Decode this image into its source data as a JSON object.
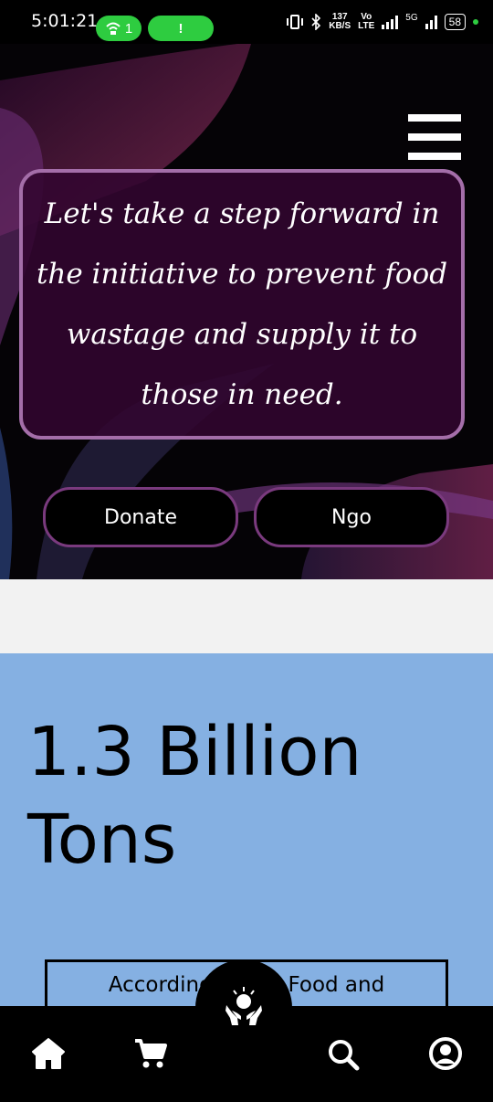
{
  "status_bar": {
    "time": "5:01:21",
    "hotspot_count": "1",
    "alert": "!",
    "speed_value": "137",
    "speed_unit": "KB/S",
    "volte_top": "Vo",
    "volte_bottom": "LTE",
    "network": "5G",
    "battery": "58"
  },
  "hero": {
    "quote": "Let's take a step forward in the initiative to prevent food wastage and supply it to those in need.",
    "donate_label": "Donate",
    "ngo_label": "Ngo"
  },
  "stats": {
    "heading": "1.3 Billion Tons",
    "info_text": "According to the Food and"
  },
  "bottom_nav": {
    "items": [
      "home-icon",
      "cart-icon",
      "donate-hands-icon",
      "search-icon",
      "profile-icon"
    ]
  },
  "colors": {
    "hero_card_border": "#a46ea9",
    "stats_background": "#85b0e2",
    "status_green": "#2ecc40"
  }
}
